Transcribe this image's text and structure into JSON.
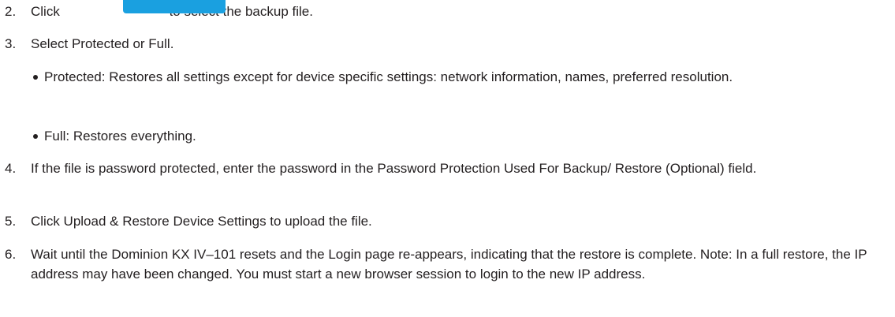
{
  "steps": [
    {
      "num": "2.",
      "before": "Click",
      "after": "to select the backup file."
    },
    {
      "num": "3.",
      "text": "Select Protected or Full."
    },
    {
      "num": "4.",
      "text": "If the file is password protected, enter the password in the Password Protection Used For Backup/ Restore (Optional) field."
    },
    {
      "num": "5.",
      "text": "Click Upload & Restore Device Settings to upload the file."
    },
    {
      "num": "6.",
      "text": "Wait until the Dominion KX IV–101 resets and the Login page re-appears, indicating that the restore is complete. Note: In a full restore, the IP address may have been changed. You must start a new browser session to login to the new IP address."
    }
  ],
  "bullets": [
    "Protected: Restores all settings except for device specific settings: network information, names, preferred resolution.",
    "Full: Restores everything."
  ],
  "colors": {
    "button": "#1aa0e0",
    "text": "#231f20"
  }
}
